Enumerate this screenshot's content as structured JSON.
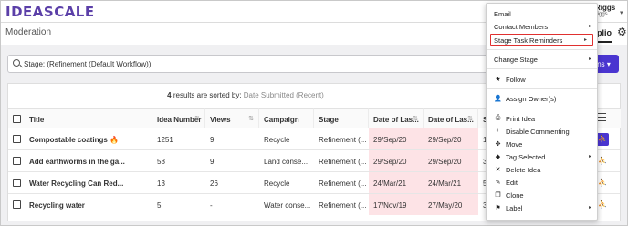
{
  "app": {
    "logo": "IDEASCALE",
    "user_name": "Riggs",
    "user_sub": "jnriggs",
    "page_title": "Moderation",
    "tab_fragment": "plio"
  },
  "search": {
    "value": "Stage: (Refinement (Default Workflow))"
  },
  "actions_label": "ions",
  "results": {
    "count": "4",
    "text": " results are sorted by: ",
    "sort_value": "Date Submitted (Recent)"
  },
  "table": {
    "columns": [
      "Title",
      "Idea Number",
      "Views",
      "Campaign",
      "Stage",
      "Date of Las...",
      "Date of Las...",
      "S"
    ],
    "rows": [
      {
        "title": "Compostable coatings",
        "fire": "🔥",
        "idea_number": "1251",
        "views": "9",
        "campaign": "Recycle",
        "stage": "Refinement (...",
        "date1": "29/Sep/20",
        "date2": "29/Sep/20",
        "s": "1."
      },
      {
        "title": "Add earthworms in the ga...",
        "fire": "",
        "idea_number": "58",
        "views": "9",
        "campaign": "Land conse...",
        "stage": "Refinement (...",
        "date1": "29/Sep/20",
        "date2": "29/Sep/20",
        "s": "3"
      },
      {
        "title": "Water Recycling Can Red...",
        "fire": "",
        "idea_number": "13",
        "views": "26",
        "campaign": "Recycle",
        "stage": "Refinement (...",
        "date1": "24/Mar/21",
        "date2": "24/Mar/21",
        "s": "5"
      },
      {
        "title": "Recycling water",
        "fire": "",
        "idea_number": "5",
        "views": "-",
        "campaign": "Water conse...",
        "stage": "Refinement (...",
        "date1": "17/Nov/19",
        "date2": "27/May/20",
        "s": "3"
      }
    ]
  },
  "menu": {
    "email": "Email",
    "contact_members": "Contact Members",
    "stage_task_reminders": "Stage Task Reminders",
    "change_stage": "Change Stage",
    "follow": "Follow",
    "assign_owners": "Assign Owner(s)",
    "print_idea": "Print Idea",
    "disable_commenting": "Disable Commenting",
    "move": "Move",
    "tag_selected": "Tag Selected",
    "delete_idea": "Delete Idea",
    "edit": "Edit",
    "clone": "Clone",
    "label": "Label"
  },
  "colors": {
    "brand": "#5b3fa8",
    "accent": "#4a35d0",
    "highlight_border": "#e0302f",
    "date_highlight": "#fde3e6"
  },
  "icons": [
    "search-icon",
    "gear-icon",
    "star-icon",
    "person-add-icon",
    "print-icon",
    "toggle-icon",
    "move-icon",
    "tag-icon",
    "close-icon",
    "edit-icon",
    "clone-icon",
    "flag-icon",
    "filter-icon",
    "runner-icon"
  ]
}
